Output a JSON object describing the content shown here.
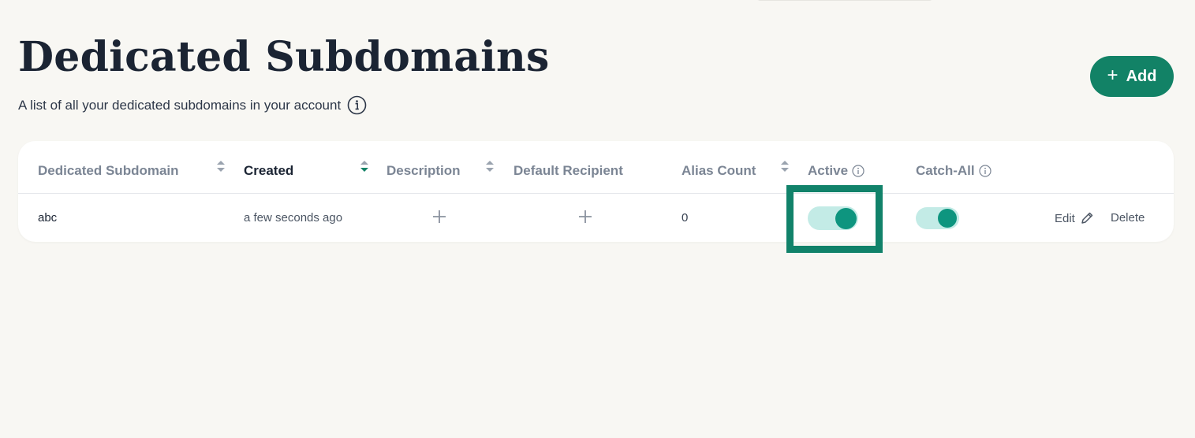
{
  "header": {
    "title": "Dedicated Subdomains",
    "subtitle": "A list of all your dedicated subdomains in your account",
    "add_label": "Add"
  },
  "table": {
    "columns": [
      {
        "key": "subdomain",
        "label": "Dedicated Subdomain",
        "sortable": true
      },
      {
        "key": "created",
        "label": "Created",
        "sortable": true,
        "sorted": "desc"
      },
      {
        "key": "description",
        "label": "Description",
        "sortable": true
      },
      {
        "key": "recipient",
        "label": "Default Recipient",
        "sortable": false
      },
      {
        "key": "alias_count",
        "label": "Alias Count",
        "sortable": true
      },
      {
        "key": "active",
        "label": "Active",
        "info": true
      },
      {
        "key": "catch_all",
        "label": "Catch-All",
        "info": true
      }
    ],
    "rows": [
      {
        "subdomain": "abc",
        "created": "a few seconds ago",
        "alias_count": "0",
        "active": true,
        "catch_all": true,
        "edit_label": "Edit",
        "delete_label": "Delete"
      }
    ]
  },
  "colors": {
    "accent": "#128266",
    "toggle_track": "#c3ebe6",
    "toggle_knob": "#0e957f",
    "background": "#f8f7f3"
  },
  "icons": [
    "info-icon",
    "plus-icon",
    "sort-icon",
    "pencil-icon"
  ]
}
